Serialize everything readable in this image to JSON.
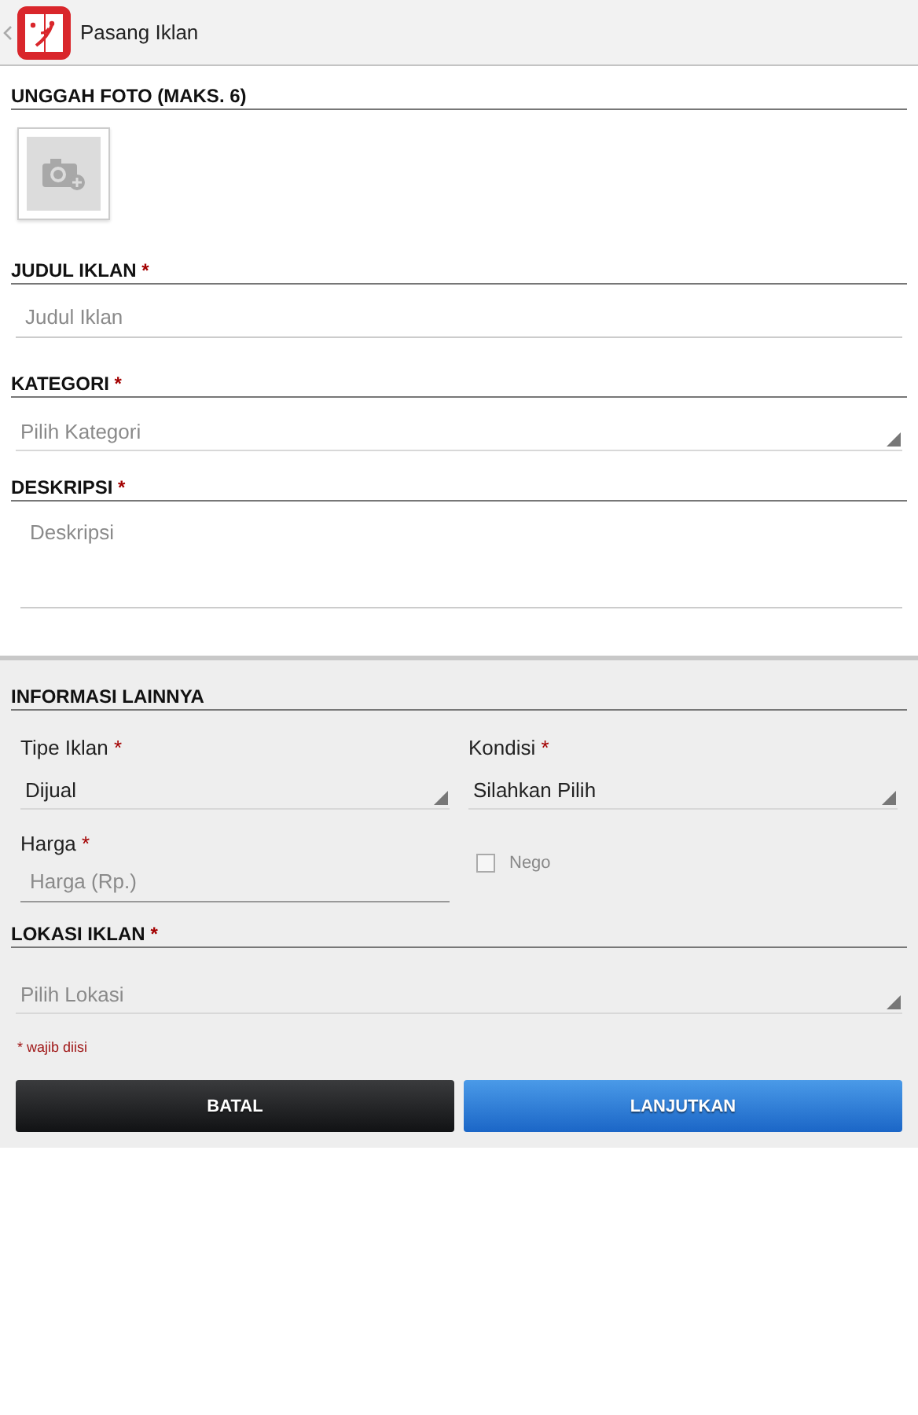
{
  "app_bar": {
    "title": "Pasang Iklan"
  },
  "photo_upload": {
    "heading": "UNGGAH FOTO (MAKS. 6)"
  },
  "fields": [
    {
      "kind": "input",
      "label": "JUDUL IKLAN",
      "mark": "*",
      "placeholder": "Judul Iklan"
    },
    {
      "kind": "select",
      "label": "KATEGORI",
      "mark": "*",
      "placeholder": "Pilih Kategori"
    },
    {
      "kind": "textarea",
      "label": "DESKRIPSI",
      "mark": "*",
      "placeholder": "Deskripsi"
    }
  ],
  "other_info": {
    "heading": "INFORMASI LAINNYA",
    "ad_type": {
      "label": "Tipe Iklan",
      "mark": "*",
      "value": "Dijual"
    },
    "condition": {
      "label": "Kondisi",
      "mark": "*",
      "value": "Silahkan Pilih"
    },
    "price": {
      "label": "Harga",
      "mark": "*",
      "placeholder": "Harga (Rp.)"
    },
    "nego": {
      "label": "Nego",
      "checked": false
    }
  },
  "location": {
    "label": "LOKASI IKLAN",
    "mark": "*",
    "placeholder": "Pilih Lokasi"
  },
  "required_note": "* wajib diisi",
  "buttons": [
    {
      "kind": "cancel",
      "label": "BATAL"
    },
    {
      "kind": "primary",
      "label": "LANJUTKAN"
    }
  ]
}
